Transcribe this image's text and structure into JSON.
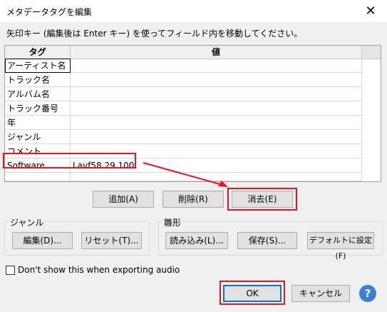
{
  "window": {
    "title": "メタデータタグを編集",
    "close_glyph": "✕"
  },
  "hint": "矢印キー (編集後は Enter キー) を使ってフィールド内を移動してください。",
  "grid": {
    "headers": {
      "tag": "タグ",
      "value": "値"
    },
    "rows": [
      {
        "tag": "アーティスト名",
        "value": ""
      },
      {
        "tag": "トラック名",
        "value": ""
      },
      {
        "tag": "アルバム名",
        "value": ""
      },
      {
        "tag": "トラック番号",
        "value": ""
      },
      {
        "tag": "年",
        "value": ""
      },
      {
        "tag": "ジャンル",
        "value": ""
      },
      {
        "tag": "コメント",
        "value": ""
      },
      {
        "tag": "Software",
        "value": "Lavf58.29.100"
      },
      {
        "tag": "",
        "value": ""
      }
    ]
  },
  "row_buttons": {
    "add": "追加(A)",
    "remove": "削除(R)",
    "clear": "消去(E)"
  },
  "genre_group": {
    "label": "ジャンル",
    "edit": "編集(D)...",
    "reset": "リセット(T)..."
  },
  "template_group": {
    "label": "雛形",
    "load": "読み込み(L)...",
    "save": "保存(S)...",
    "set_default": "デフォルトに設定(F)"
  },
  "dont_show": {
    "label": "Don't show this when exporting audio",
    "checked": false
  },
  "footer": {
    "ok": "OK",
    "cancel": "キャンセル",
    "help_glyph": "?"
  },
  "colors": {
    "annotation_red": "#e8141e",
    "help_blue": "#3c7fd6",
    "focus_blue": "#0078d7"
  }
}
